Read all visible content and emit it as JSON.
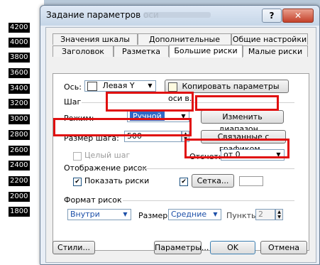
{
  "axis_ticks": [
    "4200",
    "4000",
    "3800",
    "3600",
    "3400",
    "3200",
    "3000",
    "2800",
    "2600",
    "2400",
    "2200",
    "2000",
    "1800"
  ],
  "window": {
    "title": "Задание параметров оси",
    "help_glyph": "?",
    "close_glyph": "✕"
  },
  "tabs_row1": [
    "Значения шкалы",
    "Дополнительные риски",
    "Общие настройки"
  ],
  "tabs_row2": [
    "Заголовок",
    "Разметка",
    "Большие риски",
    "Малые риски"
  ],
  "axis": {
    "label": "Ось:",
    "value": "Левая Y",
    "copy_button": "Копировать параметры оси в..."
  },
  "step": {
    "group_label": "Шаг",
    "mode_label": "Режим:",
    "mode_value": "Ручной",
    "change_range_button": "Изменить диапазон...",
    "size_label": "Размер шага:",
    "size_value": "500",
    "linked_button": "Связанные с графиком...",
    "integer_step_label": "Целый шаг",
    "origin_label": "Отсчет:",
    "origin_value": "от 0"
  },
  "display": {
    "group_label": "Отображение рисок",
    "show_ticks_label": "Показать риски",
    "grid_button": "Сетка..."
  },
  "format": {
    "group_label": "Формат рисок",
    "position_value": "Внутри",
    "size_label": "Размер:",
    "size_value": "Средние",
    "points_label": "Пункты:",
    "points_value": "2"
  },
  "footer": {
    "styles": "Стили...",
    "params": "Параметры...",
    "ok": "OK",
    "cancel": "Отмена"
  },
  "colors": {
    "highlight": "#e01010",
    "selection": "#3169c6"
  }
}
